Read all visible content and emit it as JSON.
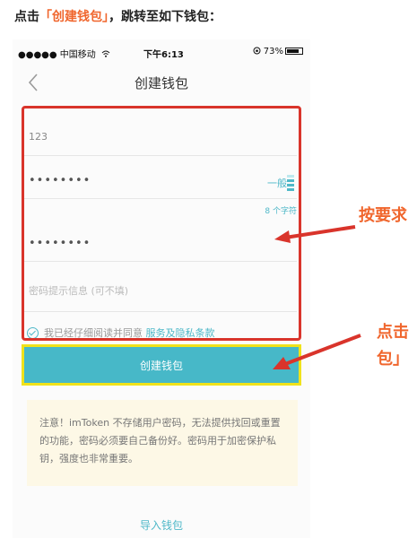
{
  "caption": {
    "prefix": "点击",
    "highlight": "「创建钱包」",
    "suffix": "，跳转至如下钱包："
  },
  "status_bar": {
    "carrier": "●●●●● 中国移动",
    "wifi_icon": "wifi-icon",
    "time": "下午6:13",
    "battery_text": "73%",
    "battery_icon": "battery-icon"
  },
  "nav": {
    "title": "创建钱包",
    "back_icon": "chevron-left-icon"
  },
  "form": {
    "wallet_name_value": "123",
    "password_value": "••••••••",
    "strength_label": "一般",
    "password_hint_count": "8 个字符",
    "repeat_password_value": "••••••••",
    "password_hint_placeholder": "密码提示信息 (可不填)",
    "agree_text": "我已经仔细阅读并同意",
    "terms_link": "服务及隐私条款"
  },
  "buttons": {
    "create_wallet": "创建钱包",
    "import_wallet": "导入钱包"
  },
  "notice": "注意！imToken 不存储用户密码，无法提供找回或重置的功能，密码必须要自己备份好。密码用于加密保护私钥，强度也非常重要。",
  "annotations": {
    "form_note": "按要求",
    "button_note_line1": "点击",
    "button_note_line2": "包」"
  },
  "colors": {
    "accent": "#47b8c8",
    "annotation_red": "#d9342b",
    "annotation_yellow": "#f0e21a",
    "caption_orange": "#f0662d"
  }
}
